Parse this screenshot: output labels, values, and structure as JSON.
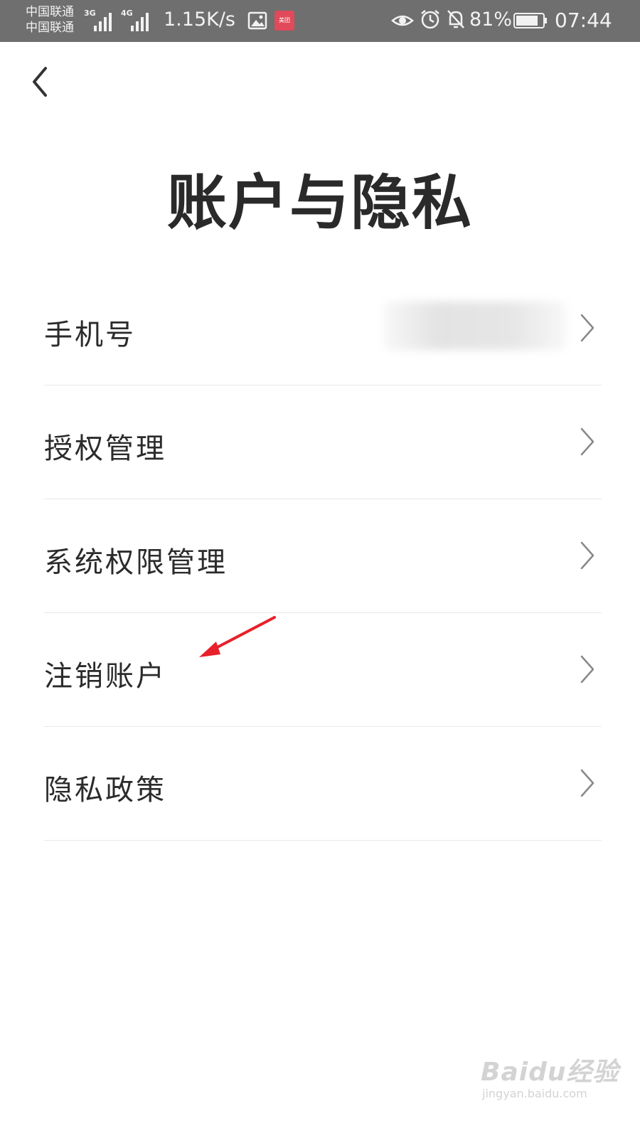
{
  "status_bar": {
    "carrier_1": "中国联通",
    "carrier_2": "中国联通",
    "network_1": "3G",
    "network_2": "4G",
    "net_speed": "1.15K/s",
    "app_badge": "美团",
    "battery": "81%",
    "time": "07:44"
  },
  "header": {
    "title": "账户与隐私"
  },
  "list": {
    "items": [
      {
        "label": "手机号"
      },
      {
        "label": "授权管理"
      },
      {
        "label": "系统权限管理"
      },
      {
        "label": "注销账户"
      },
      {
        "label": "隐私政策"
      }
    ]
  },
  "watermark": {
    "brand": "Baidu经验",
    "url": "jingyan.baidu.com"
  },
  "colors": {
    "status_bar_bg": "#6f6f6f",
    "annotation_arrow": "#e8202a",
    "divider": "#e8e8e8"
  }
}
